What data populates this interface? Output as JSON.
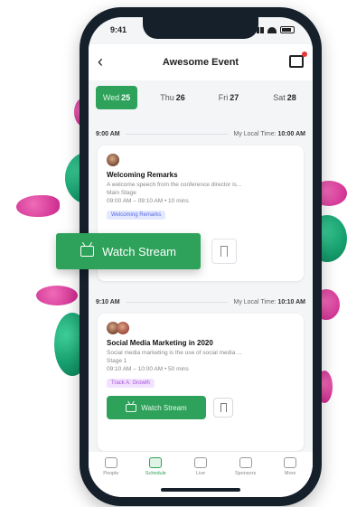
{
  "colors": {
    "accent": "#2ea25a",
    "blob_green": "#17a06f",
    "blob_pink": "#c8248a",
    "phone_frame": "#15202b"
  },
  "status_bar": {
    "time": "9:41"
  },
  "header": {
    "title": "Awesome Event",
    "back_icon": "chevron-left-icon",
    "message_icon": "message-icon"
  },
  "days": [
    {
      "dow": "Wed",
      "date": "25",
      "selected": true
    },
    {
      "dow": "Thu",
      "date": "26",
      "selected": false
    },
    {
      "dow": "Fri",
      "date": "27",
      "selected": false
    },
    {
      "dow": "Sat",
      "date": "28",
      "selected": false
    }
  ],
  "sessions": [
    {
      "time": "9:00 AM",
      "local_time_label": "My Local Time:",
      "local_time": "10:00 AM",
      "title": "Welcoming Remarks",
      "description": "A welcome speech from the conference director is...",
      "stage": "Main Stage",
      "time_range": "09:00 AM – 09:10 AM • 10 mins",
      "tag": "Welcoming Remarks",
      "button": "Watch Stream"
    },
    {
      "time": "9:10 AM",
      "local_time_label": "My Local Time:",
      "local_time": "10:10 AM",
      "title": "Social Media Marketing in 2020",
      "description": "Social media marketing is the use of social media ...",
      "stage": "Stage 1",
      "time_range": "09:10 AM – 10:00 AM • 50 mins",
      "tag": "Track A: Growth",
      "button": "Watch Stream"
    }
  ],
  "tabbar": [
    {
      "label": "People",
      "active": false
    },
    {
      "label": "Schedule",
      "active": true
    },
    {
      "label": "Live",
      "active": false
    },
    {
      "label": "Sponsors",
      "active": false
    },
    {
      "label": "More",
      "active": false
    }
  ],
  "floating_button": {
    "label": "Watch Stream",
    "icon": "tv-icon"
  }
}
